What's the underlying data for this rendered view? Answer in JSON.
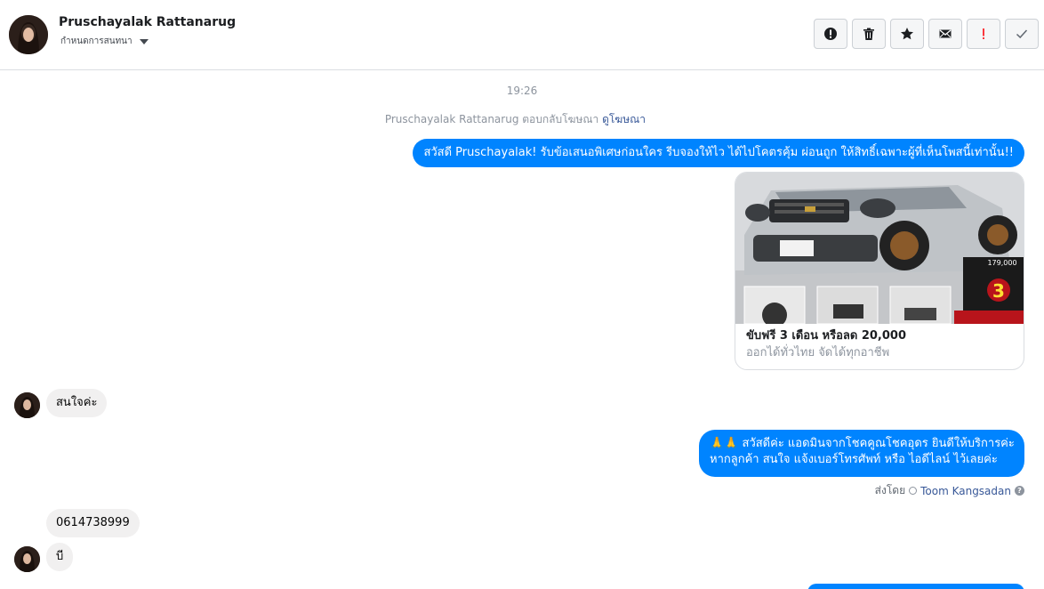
{
  "header": {
    "contact_name": "Pruschayalak Rattanarug",
    "label_text": "กำหนดการสนทนา",
    "toolbar": [
      {
        "name": "report-button",
        "icon": "alert-circle-icon",
        "color": "#1c1e21"
      },
      {
        "name": "delete-button",
        "icon": "trash-icon",
        "color": "#1c1e21"
      },
      {
        "name": "star-button",
        "icon": "star-icon",
        "color": "#1c1e21"
      },
      {
        "name": "mark-unread-button",
        "icon": "envelope-icon",
        "color": "#1c1e21"
      },
      {
        "name": "follow-up-button",
        "icon": "exclamation-icon",
        "color": "#fa383e"
      },
      {
        "name": "mark-done-button",
        "icon": "check-icon",
        "color": "#606770"
      }
    ]
  },
  "conversation": {
    "timestamp": "19:26",
    "reply_note": "Pruschayalak Rattanarug ตอบกลับโฆษณา",
    "reply_link": "ดูโฆษณา",
    "messages": {
      "out_1": "สวัสดี Pruschayalak! รับข้อเสนอพิเศษก่อนใคร รีบจองให้ไว ได้ไปโคตรคุ้ม ผ่อนถูก ให้สิทธิ์เฉพาะผู้ที่เห็นโพสนี้เท่านั้น!!",
      "ad_card": {
        "title": "ขับฟรี 3 เดือน หรือลด 20,000",
        "subtitle": "ออกได้ทั่วไทย จัดได้ทุกอาชีพ",
        "image_price": "179,000",
        "image_big_number": "3"
      },
      "in_1": "สนใจค่ะ",
      "out_2_line1": "🙏🙏 สวัสดีค่ะ แอดมินจากโชคคูณโชคอุดร ยินดีให้บริการค่ะ",
      "out_2_line2": "หากลูกค้า สนใจ แจ้งเบอร์โทรศัพท์ หรือ ไอดีไลน์ ไว้เลยค่ะ",
      "sent_by_label": "ส่งโดย",
      "sent_by_name": "Toom Kangsadan",
      "in_2": "0614738999",
      "in_3": "บี"
    }
  },
  "colors": {
    "outgoing_bubble": "#0084ff",
    "incoming_bubble": "#f1f0f0",
    "link": "#385898"
  }
}
